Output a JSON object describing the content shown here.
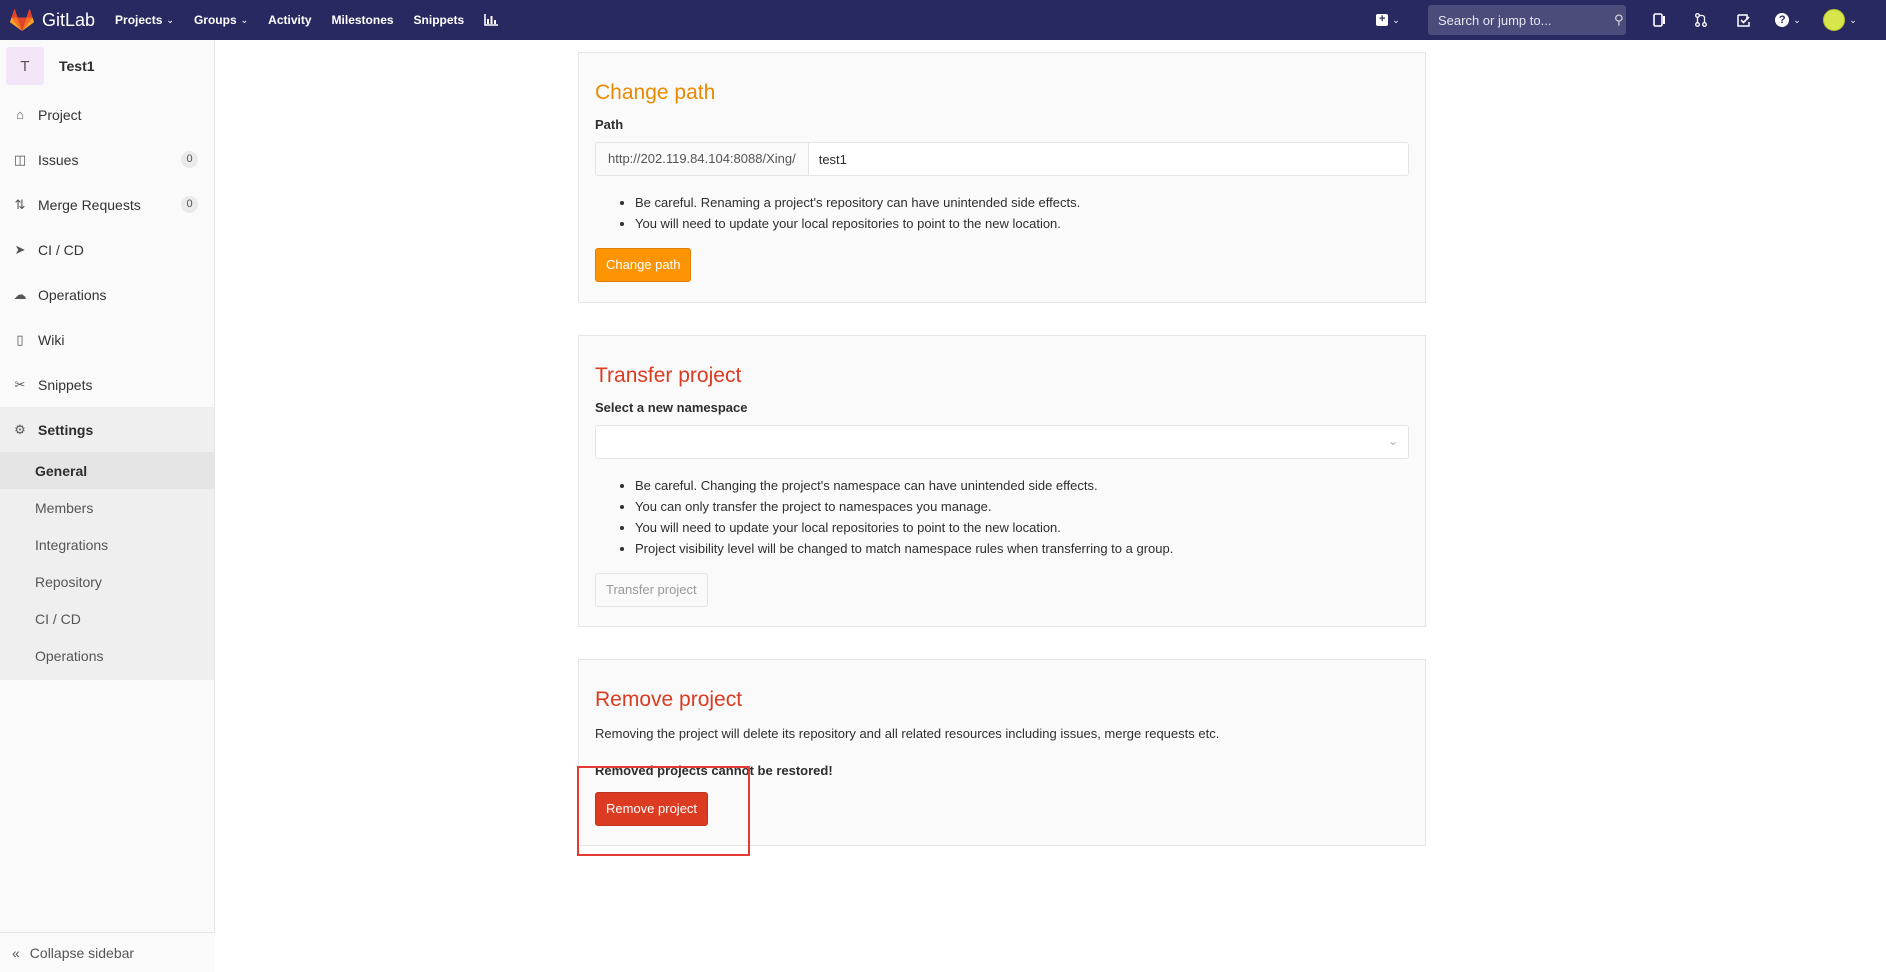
{
  "navbar": {
    "brand": "GitLab",
    "links": [
      {
        "label": "Projects",
        "dropdown": true
      },
      {
        "label": "Groups",
        "dropdown": true
      },
      {
        "label": "Activity",
        "dropdown": false
      },
      {
        "label": "Milestones",
        "dropdown": false
      },
      {
        "label": "Snippets",
        "dropdown": false
      }
    ],
    "search_placeholder": "Search or jump to..."
  },
  "sidebar": {
    "project_initial": "T",
    "project_name": "Test1",
    "items": [
      {
        "label": "Project",
        "icon": "home-icon"
      },
      {
        "label": "Issues",
        "icon": "issues-icon",
        "count": "0"
      },
      {
        "label": "Merge Requests",
        "icon": "merge-request-icon",
        "count": "0"
      },
      {
        "label": "CI / CD",
        "icon": "rocket-icon"
      },
      {
        "label": "Operations",
        "icon": "cloud-gear-icon"
      },
      {
        "label": "Wiki",
        "icon": "book-icon"
      },
      {
        "label": "Snippets",
        "icon": "scissors-icon"
      },
      {
        "label": "Settings",
        "icon": "gear-icon"
      }
    ],
    "settings_sub": [
      "General",
      "Members",
      "Integrations",
      "Repository",
      "CI / CD",
      "Operations"
    ],
    "collapse_label": "Collapse sidebar"
  },
  "change_path": {
    "title": "Change path",
    "path_label": "Path",
    "prefix": "http://202.119.84.104:8088/Xing/",
    "value": "test1",
    "notes": [
      "Be careful. Renaming a project's repository can have unintended side effects.",
      "You will need to update your local repositories to point to the new location."
    ],
    "button": "Change path"
  },
  "transfer": {
    "title": "Transfer project",
    "label": "Select a new namespace",
    "notes": [
      "Be careful. Changing the project's namespace can have unintended side effects.",
      "You can only transfer the project to namespaces you manage.",
      "You will need to update your local repositories to point to the new location.",
      "Project visibility level will be changed to match namespace rules when transferring to a group."
    ],
    "button": "Transfer project"
  },
  "remove": {
    "title": "Remove project",
    "description": "Removing the project will delete its repository and all related resources including issues, merge requests etc.",
    "warning": "Removed projects cannot be restored!",
    "button": "Remove project"
  },
  "colors": {
    "navbar": "#292961",
    "orange": "#fc9403",
    "danger": "#db3b21",
    "highlight": "#e53935"
  }
}
